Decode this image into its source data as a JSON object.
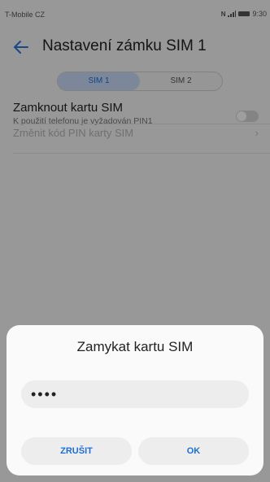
{
  "statusbar": {
    "carrier": "T-Mobile CZ",
    "time": "9:30",
    "nfc_label": "N"
  },
  "appbar": {
    "title": "Nastavení zámku SIM 1"
  },
  "segment": {
    "tabs": [
      "SIM 1",
      "SIM 2"
    ],
    "selected": "SIM 1"
  },
  "settings": {
    "lock_title": "Zamknout kartu SIM",
    "lock_subtitle": "K použití telefonu je vyžadován PIN1",
    "change_pin": "Změnit kód PIN karty SIM"
  },
  "dialog": {
    "title": "Zamykat kartu SIM",
    "pin_value": "••••",
    "cancel_label": "ZRUŠIT",
    "ok_label": "OK"
  },
  "colors": {
    "accent": "#1e6fd0",
    "segment_selected": "#c8dcf7"
  }
}
